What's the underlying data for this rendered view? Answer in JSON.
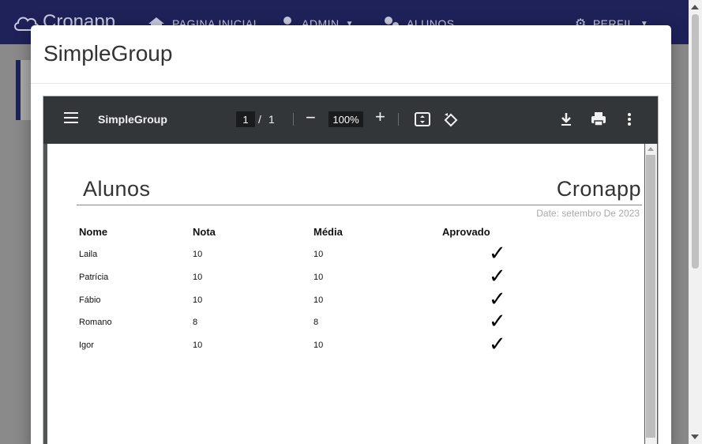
{
  "app": {
    "brand": "Cronapp",
    "nav": [
      {
        "label": "PAGINA INICIAL"
      },
      {
        "label": "ADMIN"
      },
      {
        "label": "ALUNOS"
      },
      {
        "label": "PERFIL"
      }
    ]
  },
  "modal": {
    "title": "SimpleGroup"
  },
  "pdf_viewer": {
    "doc_title": "SimpleGroup",
    "page_current": "1",
    "page_separator": "/",
    "page_total": "1",
    "zoom": "100%",
    "icons": [
      "menu-icon",
      "zoom-out-icon",
      "zoom-in-icon",
      "fit-page-icon",
      "rotate-icon",
      "download-icon",
      "print-icon",
      "more-icon"
    ]
  },
  "report": {
    "title": "Alunos",
    "brand": "Cronapp",
    "date": "Date: setembro De 2023",
    "columns": [
      "Nome",
      "Nota",
      "Média",
      "Aprovado"
    ],
    "rows": [
      {
        "nome": "Laila",
        "nota": "10",
        "media": "10",
        "aprovado": "✓"
      },
      {
        "nome": "Patrícia",
        "nota": "10",
        "media": "10",
        "aprovado": "✓"
      },
      {
        "nome": "Fábio",
        "nota": "10",
        "media": "10",
        "aprovado": "✓"
      },
      {
        "nome": "Romano",
        "nota": "8",
        "media": "8",
        "aprovado": "✓"
      },
      {
        "nome": "Igor",
        "nota": "10",
        "media": "10",
        "aprovado": "✓"
      }
    ]
  },
  "colors": {
    "nav_bg": "#1e2259",
    "pdf_toolbar_bg": "#323639",
    "pdf_viewer_bg": "#525659"
  }
}
